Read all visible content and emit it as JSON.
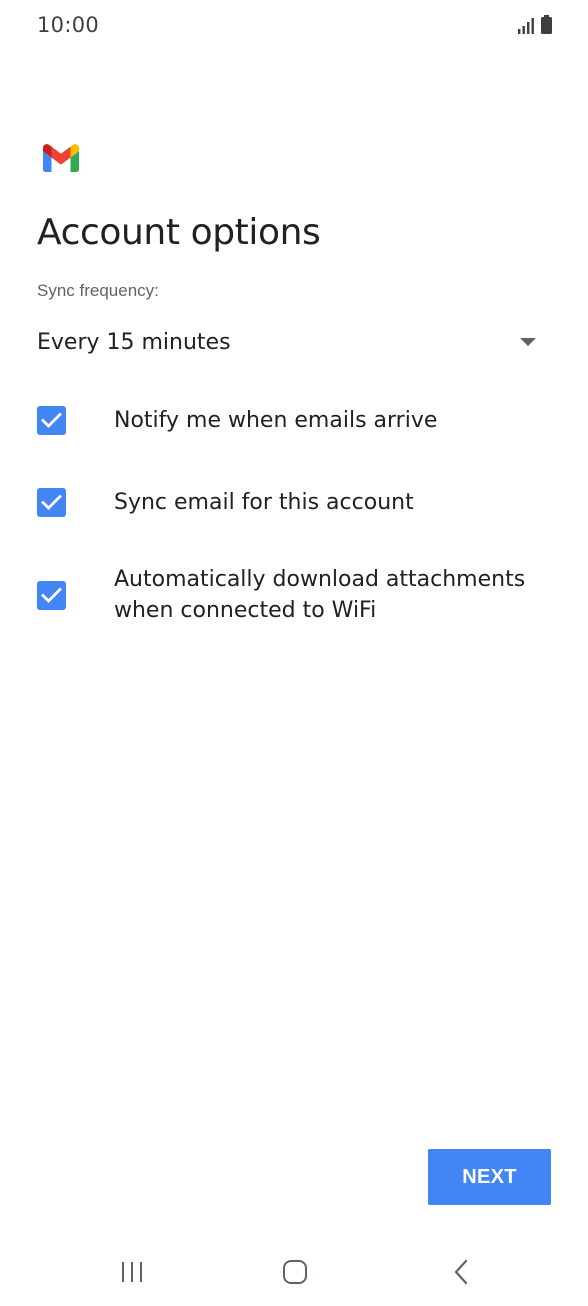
{
  "status_bar": {
    "time": "10:00",
    "signal_icon": "signal-icon",
    "battery_icon": "battery-icon"
  },
  "header": {
    "logo_icon": "gmail-logo-icon",
    "title": "Account options"
  },
  "sync": {
    "label": "Sync frequency:",
    "selected_value": "Every 15 minutes",
    "dropdown_icon": "dropdown-arrow-icon"
  },
  "options": [
    {
      "label": "Notify me when emails arrive",
      "checked": true
    },
    {
      "label": "Sync email for this account",
      "checked": true
    },
    {
      "label": "Automatically download attachments when connected to WiFi",
      "checked": true
    }
  ],
  "footer": {
    "next_label": "NEXT"
  },
  "nav": {
    "recents_icon": "recent-apps-icon",
    "home_icon": "home-icon",
    "back_icon": "back-icon"
  },
  "colors": {
    "accent": "#4285f4",
    "text_primary": "#202124",
    "text_secondary": "#5f6368"
  }
}
